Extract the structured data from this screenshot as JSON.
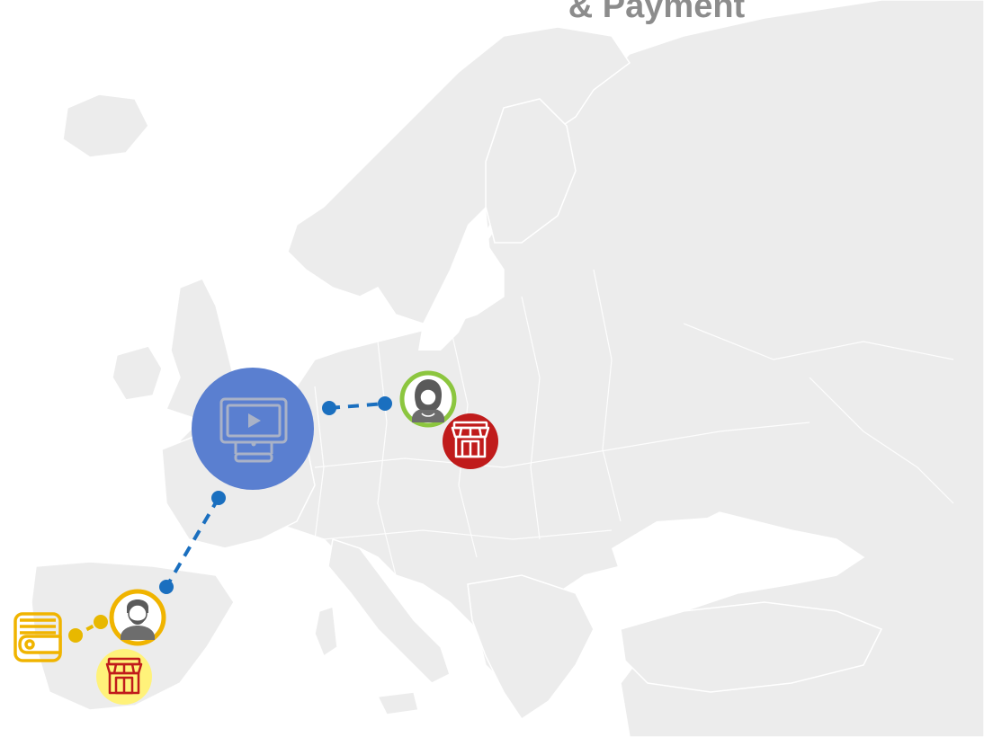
{
  "title": "& Payment",
  "colors": {
    "land": "#ececec",
    "borders": "#ffffff",
    "connector": "#1a6fbf",
    "connector_yellow": "#e8b800",
    "hub_fill": "#5a7fd0",
    "hub_icon": "#a9b2c7",
    "user_green_ring": "#8cc63f",
    "user_yellow_ring": "#f0b400",
    "shop_red": "#c01b1b",
    "shop_yellow_bg": "#fff27a",
    "wallet_yellow": "#f0b400"
  },
  "nodes": [
    {
      "id": "hub",
      "icon": "monitor-play-icon"
    },
    {
      "id": "user-north",
      "icon": "woman-avatar-icon"
    },
    {
      "id": "shop-north",
      "icon": "store-icon"
    },
    {
      "id": "user-south",
      "icon": "man-avatar-icon"
    },
    {
      "id": "shop-south",
      "icon": "store-icon"
    },
    {
      "id": "wallet",
      "icon": "wallet-icon"
    }
  ]
}
